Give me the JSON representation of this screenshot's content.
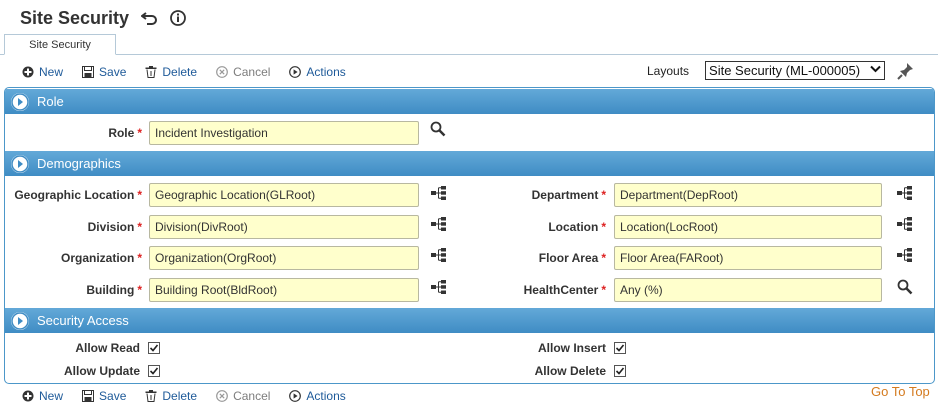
{
  "header": {
    "title": "Site Security"
  },
  "tabs": [
    {
      "label": "Site Security"
    }
  ],
  "toolbar": {
    "new_label": "New",
    "save_label": "Save",
    "delete_label": "Delete",
    "cancel_label": "Cancel",
    "actions_label": "Actions"
  },
  "layouts": {
    "label": "Layouts",
    "selected": "Site Security (ML-000005)"
  },
  "sections": {
    "role": {
      "title": "Role",
      "fields": {
        "role": {
          "label": "Role",
          "value": "Incident Investigation"
        }
      }
    },
    "demographics": {
      "title": "Demographics",
      "fields": {
        "geographic_location": {
          "label": "Geographic Location",
          "value": "Geographic Location(GLRoot)"
        },
        "division": {
          "label": "Division",
          "value": "Division(DivRoot)"
        },
        "organization": {
          "label": "Organization",
          "value": "Organization(OrgRoot)"
        },
        "building": {
          "label": "Building",
          "value": "Building Root(BldRoot)"
        },
        "department": {
          "label": "Department",
          "value": "Department(DepRoot)"
        },
        "location": {
          "label": "Location",
          "value": "Location(LocRoot)"
        },
        "floor_area": {
          "label": "Floor Area",
          "value": "Floor Area(FARoot)"
        },
        "health_center": {
          "label": "HealthCenter",
          "value": "Any (%)"
        }
      }
    },
    "security_access": {
      "title": "Security Access",
      "fields": {
        "allow_read": {
          "label": "Allow Read",
          "checked": true
        },
        "allow_update": {
          "label": "Allow Update",
          "checked": true
        },
        "allow_insert": {
          "label": "Allow Insert",
          "checked": true
        },
        "allow_delete": {
          "label": "Allow Delete",
          "checked": true
        }
      }
    }
  },
  "footer": {
    "go_to_top": "Go To Top"
  },
  "colors": {
    "section_header": "#4a97cb",
    "link": "#1e5a99",
    "input_bg": "#ffffcc",
    "required": "#dd2222",
    "go_top": "#d47a1e"
  },
  "icons": {
    "undo": "undo-arrow-icon",
    "info": "info-icon",
    "new": "plus-circle-icon",
    "save": "floppy-disk-icon",
    "delete": "trash-icon",
    "cancel": "x-circle-icon",
    "actions": "play-circle-icon",
    "pin": "pushpin-icon",
    "search": "magnifier-icon",
    "hierarchy": "tree-hierarchy-icon"
  }
}
